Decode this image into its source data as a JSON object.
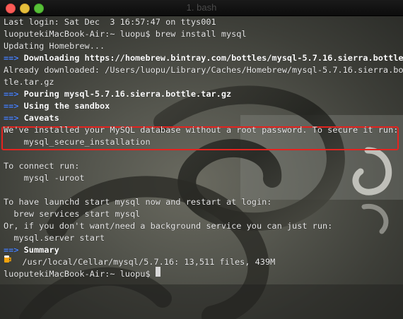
{
  "window": {
    "title": "1. bash"
  },
  "terminal": {
    "lines": [
      {
        "segments": [
          {
            "text": "Last login: Sat Dec  3 16:57:47 on ttys001"
          }
        ]
      },
      {
        "segments": [
          {
            "text": "luoputekiMacBook-Air:~ luopu$ brew install mysql"
          }
        ]
      },
      {
        "segments": [
          {
            "text": "Updating Homebrew..."
          }
        ]
      },
      {
        "segments": [
          {
            "text": "==>",
            "style": "arrow"
          },
          {
            "text": " Downloading https://homebrew.bintray.com/bottles/mysql-5.7.16.sierra.bottle.",
            "style": "bold"
          }
        ]
      },
      {
        "segments": [
          {
            "text": "Already downloaded: /Users/luopu/Library/Caches/Homebrew/mysql-5.7.16.sierra.bot"
          }
        ]
      },
      {
        "segments": [
          {
            "text": "tle.tar.gz"
          }
        ]
      },
      {
        "segments": [
          {
            "text": "==>",
            "style": "arrow"
          },
          {
            "text": " Pouring mysql-5.7.16.sierra.bottle.tar.gz",
            "style": "bold"
          }
        ]
      },
      {
        "segments": [
          {
            "text": "==>",
            "style": "arrow"
          },
          {
            "text": " Using the sandbox",
            "style": "bold"
          }
        ]
      },
      {
        "segments": [
          {
            "text": "==>",
            "style": "arrow"
          },
          {
            "text": " Caveats",
            "style": "bold"
          }
        ]
      },
      {
        "segments": [
          {
            "text": "We've installed your MySQL database without a root password. To secure it run:"
          }
        ]
      },
      {
        "segments": [
          {
            "text": "    mysql_secure_installation"
          }
        ]
      },
      {
        "segments": [
          {
            "text": ""
          }
        ]
      },
      {
        "segments": [
          {
            "text": "To connect run:"
          }
        ]
      },
      {
        "segments": [
          {
            "text": "    mysql -uroot"
          }
        ]
      },
      {
        "segments": [
          {
            "text": ""
          }
        ]
      },
      {
        "segments": [
          {
            "text": "To have launchd start mysql now and restart at login:"
          }
        ]
      },
      {
        "segments": [
          {
            "text": "  brew services start mysql"
          }
        ]
      },
      {
        "segments": [
          {
            "text": "Or, if you don't want/need a background service you can just run:"
          }
        ]
      },
      {
        "segments": [
          {
            "text": "  mysql.server start"
          }
        ]
      },
      {
        "segments": [
          {
            "text": "==>",
            "style": "arrow"
          },
          {
            "text": " Summary",
            "style": "bold"
          }
        ]
      },
      {
        "segments": [
          {
            "text": "",
            "style": "beer"
          },
          {
            "text": "  /usr/local/Cellar/mysql/5.7.16: 13,511 files, 439M"
          }
        ]
      },
      {
        "segments": [
          {
            "text": "luoputekiMacBook-Air:~ luopu$ "
          },
          {
            "text": "",
            "style": "cursor"
          }
        ]
      }
    ]
  },
  "colors": {
    "prompt_arrow": "#4d86ff",
    "highlight_box": "#e4231f",
    "text": "#eaeaea"
  },
  "icons": {
    "beer": "beer-mug-icon"
  }
}
